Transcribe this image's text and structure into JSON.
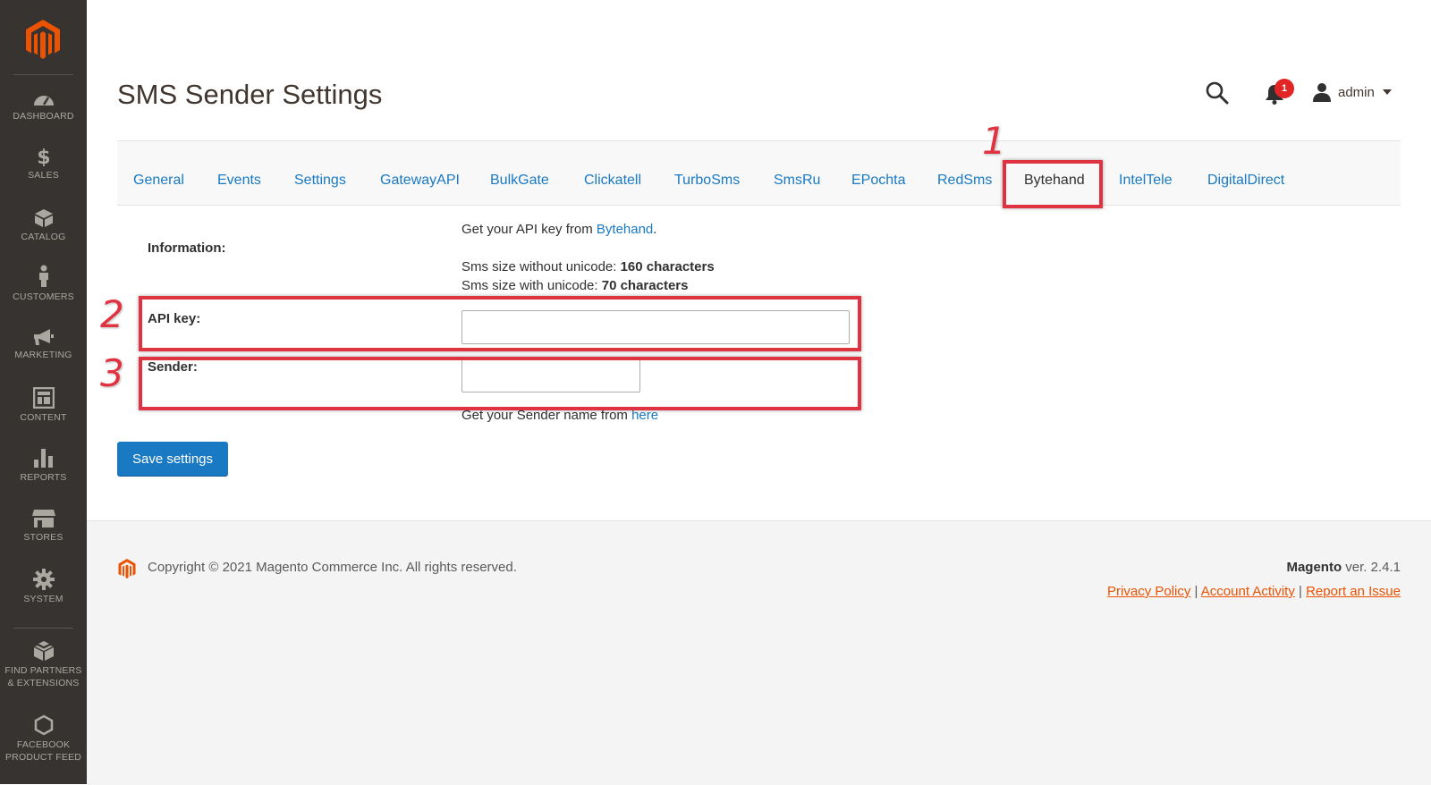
{
  "sidebar": {
    "items": [
      {
        "label": "DASHBOARD",
        "icon": "dashboard-icon"
      },
      {
        "label": "SALES",
        "icon": "dollar-icon"
      },
      {
        "label": "CATALOG",
        "icon": "box-icon"
      },
      {
        "label": "CUSTOMERS",
        "icon": "person-icon"
      },
      {
        "label": "MARKETING",
        "icon": "megaphone-icon"
      },
      {
        "label": "CONTENT",
        "icon": "layout-icon"
      },
      {
        "label": "REPORTS",
        "icon": "bar-chart-icon"
      },
      {
        "label": "STORES",
        "icon": "storefront-icon"
      },
      {
        "label": "SYSTEM",
        "icon": "gear-icon"
      },
      {
        "label": "FIND PARTNERS",
        "label2": "& EXTENSIONS",
        "icon": "cubes-icon"
      },
      {
        "label": "FACEBOOK",
        "label2": "PRODUCT FEED",
        "icon": "hexagon-icon"
      }
    ]
  },
  "header": {
    "title": "SMS Sender Settings",
    "notification_count": "1",
    "user": "admin"
  },
  "tabs": [
    {
      "label": "General"
    },
    {
      "label": "Events"
    },
    {
      "label": "Settings"
    },
    {
      "label": "GatewayAPI"
    },
    {
      "label": "BulkGate"
    },
    {
      "label": "Clickatell"
    },
    {
      "label": "TurboSms"
    },
    {
      "label": "SmsRu"
    },
    {
      "label": "EPochta"
    },
    {
      "label": "RedSms"
    },
    {
      "label": "Bytehand"
    },
    {
      "label": "IntelTele"
    },
    {
      "label": "DigitalDirect"
    }
  ],
  "active_tab": "Bytehand",
  "form": {
    "information_label": "Information:",
    "info_line1_prefix": "Get your API key from ",
    "info_line1_link": "Bytehand",
    "info_line1_suffix": ".",
    "info_line2_prefix": "Sms size without unicode: ",
    "info_line2_value": "160 characters",
    "info_line3_prefix": "Sms size with unicode: ",
    "info_line3_value": "70 characters",
    "api_key_label": "API key:",
    "api_key_value": "",
    "sender_label": "Sender:",
    "sender_value": "",
    "sender_hint_prefix": "Get your Sender name from ",
    "sender_hint_link": "here",
    "save_label": "Save settings"
  },
  "annotations": {
    "one": "1",
    "two": "2",
    "three": "3",
    "color": "#e03341"
  },
  "footer": {
    "copyright": "Copyright © 2021 Magento Commerce Inc. All rights reserved.",
    "brand": "Magento",
    "version": " ver. 2.4.1",
    "links": [
      "Privacy Policy",
      "Account Activity",
      "Report an Issue"
    ],
    "separator": "|"
  },
  "colors": {
    "accent": "#1979c3",
    "brand": "#eb5202",
    "sidebar": "#373330",
    "alert": "#e22626"
  }
}
